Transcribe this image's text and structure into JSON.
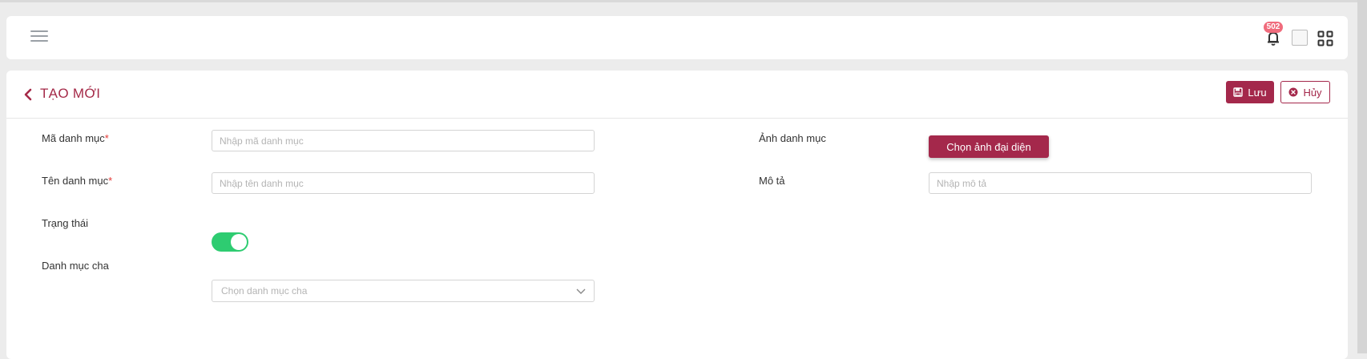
{
  "header": {
    "notification_count": "502",
    "icons": [
      "menu-icon",
      "bell-icon",
      "avatar-image",
      "apps-grid-icon"
    ]
  },
  "page": {
    "title": "TẠO MỚI",
    "save_label": "Lưu",
    "cancel_label": "Hủy"
  },
  "form": {
    "code": {
      "label": "Mã danh mục",
      "required_mark": "*",
      "placeholder": "Nhập mã danh mục",
      "value": ""
    },
    "name": {
      "label": "Tên danh mục",
      "required_mark": "*",
      "placeholder": "Nhập tên danh mục",
      "value": ""
    },
    "status": {
      "label": "Trạng thái",
      "on": true
    },
    "parent": {
      "label": "Danh mục cha",
      "placeholder": "Chọn danh mục cha"
    },
    "image": {
      "label": "Ảnh danh mục",
      "button_label": "Chọn ảnh đại diện"
    },
    "description": {
      "label": "Mô tả",
      "placeholder": "Nhập mô tả",
      "value": ""
    }
  },
  "colors": {
    "primary": "#a4284b",
    "toggle_on": "#2ecc71",
    "badge": "#f06b7c",
    "required": "#e53935"
  }
}
